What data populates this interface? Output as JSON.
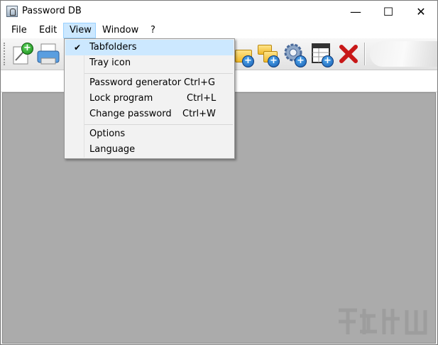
{
  "window": {
    "title": "Password DB",
    "controls": {
      "minimize": "—",
      "maximize": "☐",
      "close": "✕"
    }
  },
  "menubar": {
    "items": [
      {
        "label": "File"
      },
      {
        "label": "Edit"
      },
      {
        "label": "View",
        "active": true
      },
      {
        "label": "Window"
      },
      {
        "label": "?"
      }
    ]
  },
  "toolbar": {
    "buttons": [
      {
        "icon": "new-entry-icon"
      },
      {
        "icon": "print-icon"
      },
      {
        "icon": "add-folder-icon"
      },
      {
        "icon": "add-subfolder-icon"
      },
      {
        "icon": "add-settings-icon"
      },
      {
        "icon": "add-table-icon"
      },
      {
        "icon": "delete-icon"
      }
    ]
  },
  "view_menu": {
    "items": [
      {
        "label": "Tabfolders",
        "checked": true,
        "shortcut": ""
      },
      {
        "label": "Tray icon",
        "checked": false,
        "shortcut": ""
      },
      {
        "label": "Password generator",
        "shortcut": "Ctrl+G"
      },
      {
        "label": "Lock program",
        "shortcut": "Ctrl+L"
      },
      {
        "label": "Change password",
        "shortcut": "Ctrl+W"
      },
      {
        "label": "Options",
        "shortcut": ""
      },
      {
        "label": "Language",
        "shortcut": ""
      }
    ]
  },
  "colors": {
    "menu_highlight": "#cce8ff",
    "workspace": "#ababab",
    "delete_red": "#c81818"
  }
}
